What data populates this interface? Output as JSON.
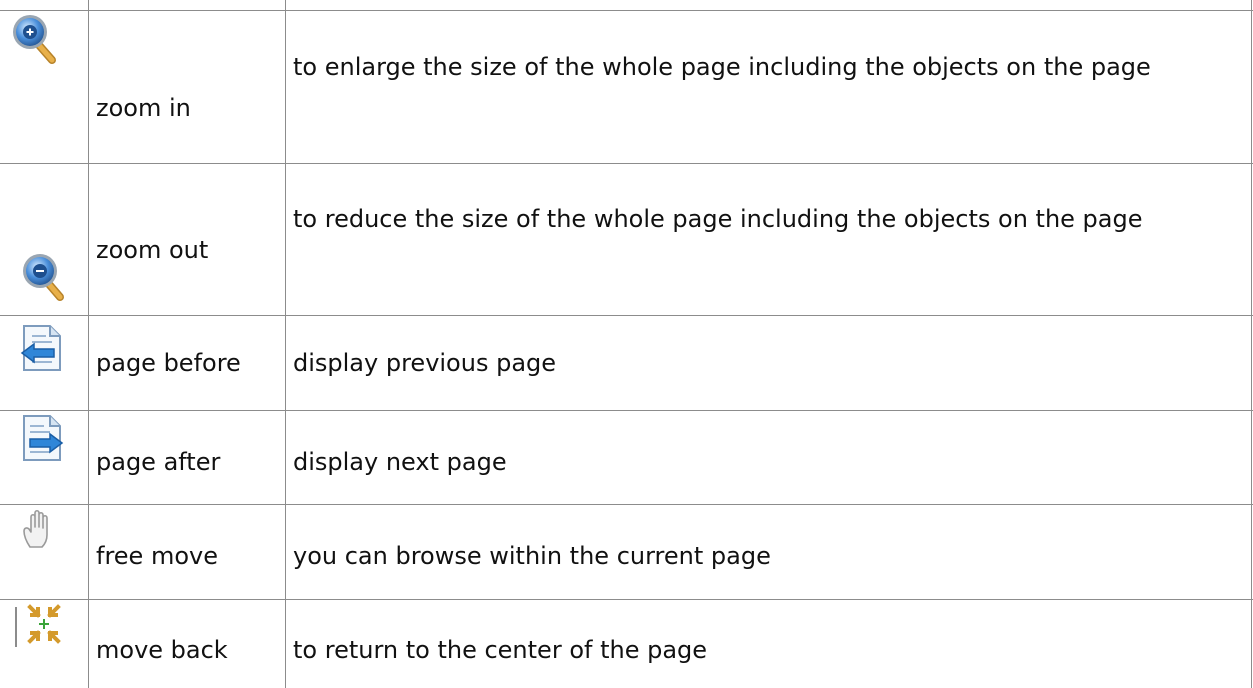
{
  "table": {
    "rows": [
      {
        "icon": "zoom-in-icon",
        "label": "zoom in",
        "description": "to enlarge the size of the whole page including the objects on the page"
      },
      {
        "icon": "zoom-out-icon",
        "label": "zoom out",
        "description": "to reduce the size of the whole page including the objects on the page"
      },
      {
        "icon": "page-before-icon",
        "label": "page before",
        "description": "display previous page"
      },
      {
        "icon": "page-after-icon",
        "label": "page after",
        "description": "display next page"
      },
      {
        "icon": "hand-icon",
        "label": "free move",
        "description": "you can browse within the current page"
      },
      {
        "icon": "move-back-icon",
        "label": "move back",
        "description": "to return to the center of the page"
      }
    ]
  },
  "colors": {
    "border": "#8c8c8c",
    "icon_blue": "#3a7fcc",
    "icon_gold": "#d49a2c"
  }
}
